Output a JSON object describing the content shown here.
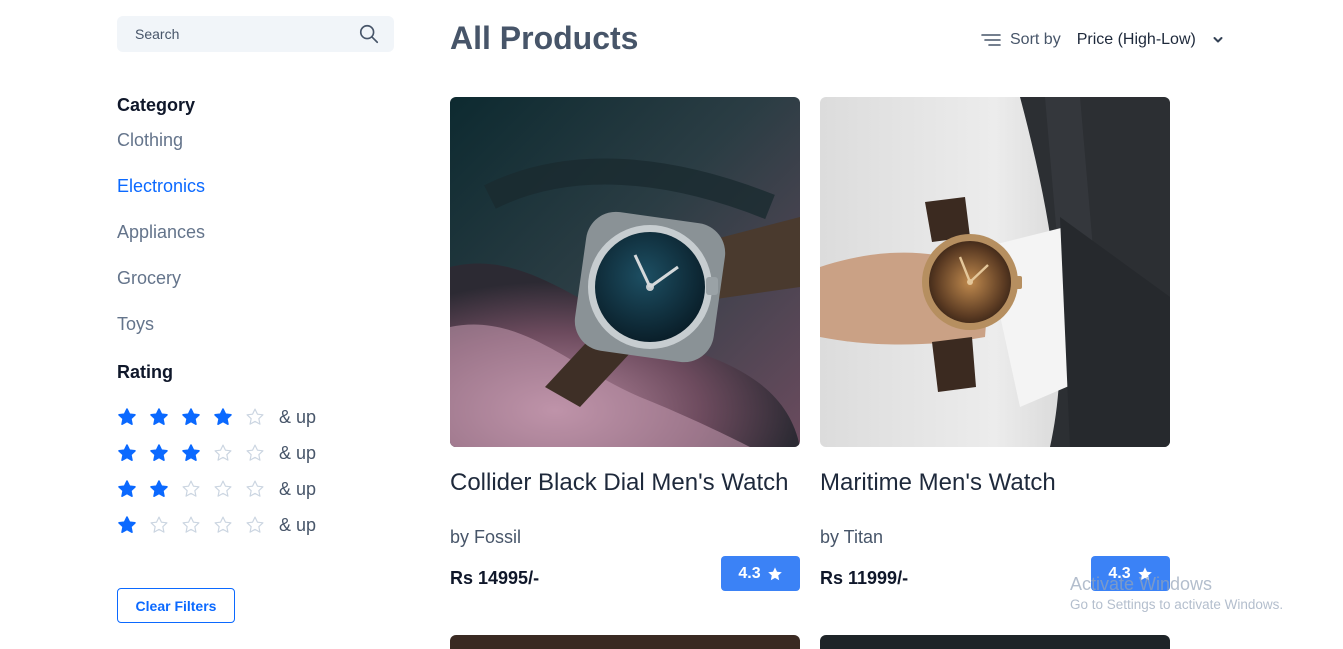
{
  "search": {
    "placeholder": "Search"
  },
  "filters": {
    "category_title": "Category",
    "categories": [
      {
        "label": "Clothing",
        "active": false
      },
      {
        "label": "Electronics",
        "active": true
      },
      {
        "label": "Appliances",
        "active": false
      },
      {
        "label": "Grocery",
        "active": false
      },
      {
        "label": "Toys",
        "active": false
      }
    ],
    "rating_title": "Rating",
    "rating_options": [
      {
        "stars": 4,
        "suffix": "& up"
      },
      {
        "stars": 3,
        "suffix": "& up"
      },
      {
        "stars": 2,
        "suffix": "& up"
      },
      {
        "stars": 1,
        "suffix": "& up"
      }
    ],
    "clear_label": "Clear Filters"
  },
  "header": {
    "title": "All Products",
    "sort_label": "Sort by",
    "sort_value": "Price (High-Low)"
  },
  "products": [
    {
      "title": "Collider Black Dial Men's Watch",
      "brand": "by Fossil",
      "price": "Rs 14995/-",
      "rating": "4.3"
    },
    {
      "title": "Maritime Men's Watch",
      "brand": "by Titan",
      "price": "Rs 11999/-",
      "rating": "4.3"
    }
  ],
  "watermark": {
    "title": "Activate Windows",
    "subtitle": "Go to Settings to activate Windows."
  },
  "colors": {
    "accent": "#0b69ff",
    "badge": "#3b82f6",
    "star_filled": "#0b69ff",
    "star_empty": "#cbd5e1"
  }
}
